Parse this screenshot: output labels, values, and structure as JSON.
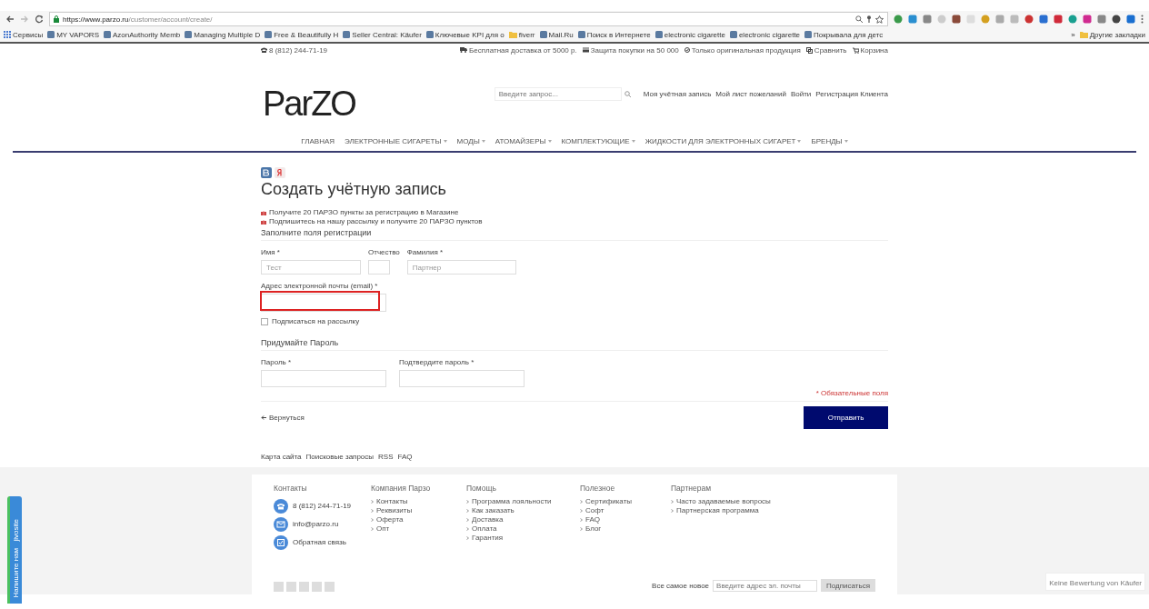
{
  "browser": {
    "url_host": "https://www.parzo.ru",
    "url_path": "/customer/account/create/",
    "bookmarks": [
      {
        "label": "Сервисы",
        "kind": "apps"
      },
      {
        "label": "MY VAPORS",
        "kind": "site"
      },
      {
        "label": "AzonAuthority Memb",
        "kind": "site"
      },
      {
        "label": "Managing Multiple D",
        "kind": "site"
      },
      {
        "label": "Free & Beautifully H",
        "kind": "site"
      },
      {
        "label": "Seller Central: Käufer",
        "kind": "site"
      },
      {
        "label": "Ключевые KPI для о",
        "kind": "site"
      },
      {
        "label": "fiverr",
        "kind": "folder"
      },
      {
        "label": "Mail.Ru",
        "kind": "site"
      },
      {
        "label": "Поиск в Интернете",
        "kind": "site"
      },
      {
        "label": "electronic cigarette",
        "kind": "site"
      },
      {
        "label": "electronic cigarette",
        "kind": "site"
      },
      {
        "label": "Покрывала для детс",
        "kind": "site"
      }
    ],
    "more": "»",
    "other_bookmarks": "Другие закладки"
  },
  "topbar": {
    "phone": "8 (812) 244-71-19",
    "perks": [
      "Бесплатная доставка от 5000 р.",
      "Защита покупки на 50 000",
      "Только оригинальная продукция"
    ],
    "compare": "Сравнить",
    "cart": "Корзина"
  },
  "header": {
    "logo": "ParZO",
    "search": {
      "placeholder": "Введите запрос..."
    },
    "account_links": [
      "Моя учётная запись",
      "Мой лист пожеланий",
      "Войти",
      "Регистрация Клиента"
    ]
  },
  "nav": [
    {
      "label": "ГЛАВНАЯ",
      "dropdown": false
    },
    {
      "label": "ЭЛЕКТРОННЫЕ СИГАРЕТЫ",
      "dropdown": true
    },
    {
      "label": "МОДЫ",
      "dropdown": true
    },
    {
      "label": "АТОМАЙЗЕРЫ",
      "dropdown": true
    },
    {
      "label": "КОМПЛЕКТУЮЩИЕ",
      "dropdown": true
    },
    {
      "label": "ЖИДКОСТИ ДЛЯ ЭЛЕКТРОННЫХ СИГАРЕТ",
      "dropdown": true
    },
    {
      "label": "БРЕНДЫ",
      "dropdown": true
    }
  ],
  "form": {
    "title": "Создать учётную запись",
    "bonuses": [
      "Получите 20 ПАРЗО пункты за регистрацию в Магазине",
      "Подпишитесь на нашу рассылку и получите 20 ПАРЗО пунктов"
    ],
    "section_1": "Заполните поля регистрации",
    "name_fields": [
      {
        "label": "Имя *",
        "value": "Тест"
      },
      {
        "label": "Отчество"
      },
      {
        "label": "Фамилия *",
        "value": "Партнер"
      }
    ],
    "email": {
      "label": "Адрес электронной почты (email) *",
      "highlighted": true
    },
    "subscribe": {
      "label": "Подписаться на рассылку",
      "checked": false
    },
    "section_2": "Придумайте Пароль",
    "password_fields": [
      {
        "label": "Пароль *"
      },
      {
        "label": "Подтвердите пароль *"
      }
    ],
    "required_note": "* Обязательные поля",
    "back": "Вернуться",
    "submit": "Отправить"
  },
  "footer_links": [
    "Карта сайта",
    "Поисковые запросы",
    "RSS",
    "FAQ"
  ],
  "footer": {
    "contacts": {
      "title": "Контакты",
      "items": [
        {
          "kind": "phone",
          "text": "8 (812) 244-71-19"
        },
        {
          "kind": "email",
          "text": "info@parzo.ru"
        },
        {
          "kind": "feedback",
          "text": "Обратная связь"
        }
      ]
    },
    "columns": [
      {
        "title": "Компания Парзо",
        "items": [
          "Контакты",
          "Реквизиты",
          "Оферта",
          "Опт"
        ]
      },
      {
        "title": "Помощь",
        "items": [
          "Программа лояльности",
          "Как заказать",
          "Доставка",
          "Оплата",
          "Гарантия"
        ]
      },
      {
        "title": "Полезное",
        "items": [
          "Сертификаты",
          "Софт",
          "FAQ",
          "Блог"
        ]
      },
      {
        "title": "Партнерам",
        "items": [
          "Часто задаваемые вопросы",
          "Партнерская программа"
        ]
      }
    ],
    "newsletter": {
      "label": "Все самое новое",
      "placeholder": "Введите адрес эл. почты",
      "button": "Подписаться"
    }
  },
  "chat_tab": {
    "brand": "jivosite",
    "label": "Напишите нам"
  },
  "rating_badge": "Keine Bewertung von Käufer"
}
